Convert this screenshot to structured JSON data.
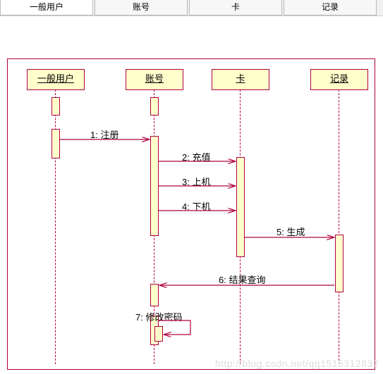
{
  "tabs": {
    "t1": "一般用户",
    "t2": "账号",
    "t3": "卡",
    "t4": "记录"
  },
  "lifelines": {
    "user": "一般用户",
    "account": "账号",
    "card": "卡",
    "record": "记录"
  },
  "messages": {
    "m1": "1: 注册",
    "m2": "2: 充值",
    "m3": "3: 上机",
    "m4": "4: 下机",
    "m5": "5: 生成",
    "m6": "6: 结果查询",
    "m7": "7: 修改密码"
  },
  "watermark": "http://blog.csdn.net/qq1515312832",
  "chart_data": {
    "type": "table",
    "description": "UML sequence diagram",
    "lifelines": [
      "一般用户",
      "账号",
      "卡",
      "记录"
    ],
    "messages": [
      {
        "seq": 1,
        "from": "一般用户",
        "to": "账号",
        "label": "注册"
      },
      {
        "seq": 2,
        "from": "账号",
        "to": "卡",
        "label": "充值"
      },
      {
        "seq": 3,
        "from": "账号",
        "to": "卡",
        "label": "上机"
      },
      {
        "seq": 4,
        "from": "账号",
        "to": "卡",
        "label": "下机"
      },
      {
        "seq": 5,
        "from": "卡",
        "to": "记录",
        "label": "生成"
      },
      {
        "seq": 6,
        "from": "记录",
        "to": "账号",
        "label": "结果查询"
      },
      {
        "seq": 7,
        "from": "账号",
        "to": "账号",
        "label": "修改密码",
        "self": true
      }
    ]
  }
}
